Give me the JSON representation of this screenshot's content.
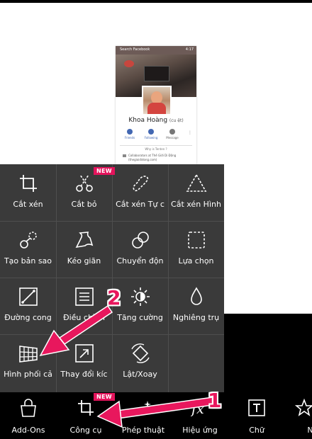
{
  "preview": {
    "name": "Khoa Hoàng",
    "name_suffix": "(cu ệt)",
    "status_left": "Search Facebook",
    "status_right": "4:17",
    "actions": [
      "Friends",
      "Following",
      "Message"
    ],
    "more": "⋮",
    "why_text": "Why is Tenten ?",
    "work_text": "Collaborators at Thế Giới Di Động (thegioididong.com)"
  },
  "tools": {
    "badge": "NEW",
    "items": [
      {
        "label": "Cắt xén",
        "icon": "crop-icon"
      },
      {
        "label": "Cắt bỏ",
        "icon": "scissors-icon",
        "new": true
      },
      {
        "label": "Cắt xén Tự c",
        "icon": "freecrop-icon"
      },
      {
        "label": "Cắt xén Hình",
        "icon": "shapecrop-icon"
      },
      {
        "label": "Tạo bản sao",
        "icon": "clone-icon"
      },
      {
        "label": "Kéo giãn",
        "icon": "stretch-icon"
      },
      {
        "label": "Chuyển độn",
        "icon": "motion-icon"
      },
      {
        "label": "Lựa chọn",
        "icon": "selection-icon"
      },
      {
        "label": "Đường cong",
        "icon": "curves-icon"
      },
      {
        "label": "Điều chỉnh",
        "icon": "adjust-icon"
      },
      {
        "label": "Tăng cường",
        "icon": "enhance-icon"
      },
      {
        "label": "Nghiêng trụ",
        "icon": "tiltshift-icon"
      },
      {
        "label": "Hình phối cả",
        "icon": "perspective-icon"
      },
      {
        "label": "Thay đổi kíc",
        "icon": "resize-icon"
      },
      {
        "label": "Lật/Xoay",
        "icon": "fliprotate-icon"
      }
    ]
  },
  "toolbar": {
    "badge": "NEW",
    "items": [
      {
        "label": "Add-Ons",
        "icon": "shopping-bag-icon"
      },
      {
        "label": "Công cụ",
        "icon": "crop-icon",
        "new": true
      },
      {
        "label": "Phép thuật",
        "icon": "magic-icon"
      },
      {
        "label": "Hiệu ứng",
        "icon": "fx-icon"
      },
      {
        "label": "Chữ",
        "icon": "text-icon"
      },
      {
        "label": "Nh",
        "icon": "sticker-icon"
      }
    ]
  },
  "annotations": {
    "step1": "1",
    "step2": "2"
  },
  "colors": {
    "accent": "#e8175d",
    "panel": "#3a3a3a",
    "toolbar": "#000000"
  }
}
